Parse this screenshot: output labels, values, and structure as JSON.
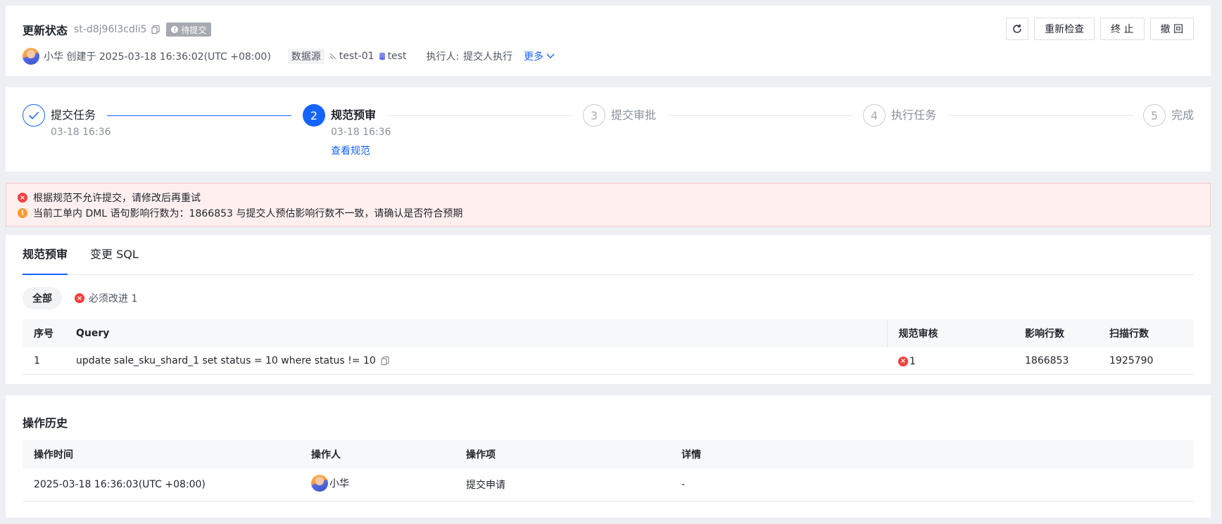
{
  "header": {
    "title": "更新状态",
    "task_id": "st-d8j96l3cdli5",
    "status": "待提交",
    "creator_line": "小华 创建于 2025-03-18 16:36:02(UTC +08:00)",
    "datasource_label": "数据源",
    "datasource_instance": "test-01",
    "datasource_db": "test",
    "executor_label": "执行人:",
    "executor_value": "提交人执行",
    "more_label": "更多",
    "buttons": {
      "recheck": "重新检查",
      "terminate": "终 止",
      "withdraw": "撤 回"
    }
  },
  "steps": [
    {
      "index": "1",
      "title": "提交任务",
      "time": "03-18 16:36",
      "state": "done"
    },
    {
      "index": "2",
      "title": "规范预审",
      "time": "03-18 16:36",
      "link": "查看规范",
      "state": "active"
    },
    {
      "index": "3",
      "title": "提交审批",
      "state": "todo"
    },
    {
      "index": "4",
      "title": "执行任务",
      "state": "todo"
    },
    {
      "index": "5",
      "title": "完成",
      "state": "todo"
    }
  ],
  "alert": {
    "error": "根据规范不允许提交，请修改后再重试",
    "warning": "当前工单内 DML 语句影响行数为：1866853 与提交人预估影响行数不一致，请确认是否符合预期"
  },
  "review": {
    "tabs": [
      "规范预审",
      "变更 SQL"
    ],
    "filter_all": "全部",
    "filter_must": "必须改进 1",
    "columns": [
      "序号",
      "Query",
      "规范审核",
      "影响行数",
      "扫描行数"
    ],
    "rows": [
      {
        "no": "1",
        "query": "update sale_sku_shard_1 set status = 10 where status != 10",
        "check": "1",
        "affected": "1866853",
        "scanned": "1925790"
      }
    ]
  },
  "history": {
    "title": "操作历史",
    "columns": [
      "操作时间",
      "操作人",
      "操作项",
      "详情"
    ],
    "rows": [
      {
        "time": "2025-03-18 16:36:03(UTC +08:00)",
        "user": "小华",
        "action": "提交申请",
        "detail": "-"
      }
    ]
  },
  "colors": {
    "primary": "#1664ff",
    "error": "#f53f3f",
    "warning": "#ff9a2e",
    "alert_bg": "#fff0ef"
  }
}
